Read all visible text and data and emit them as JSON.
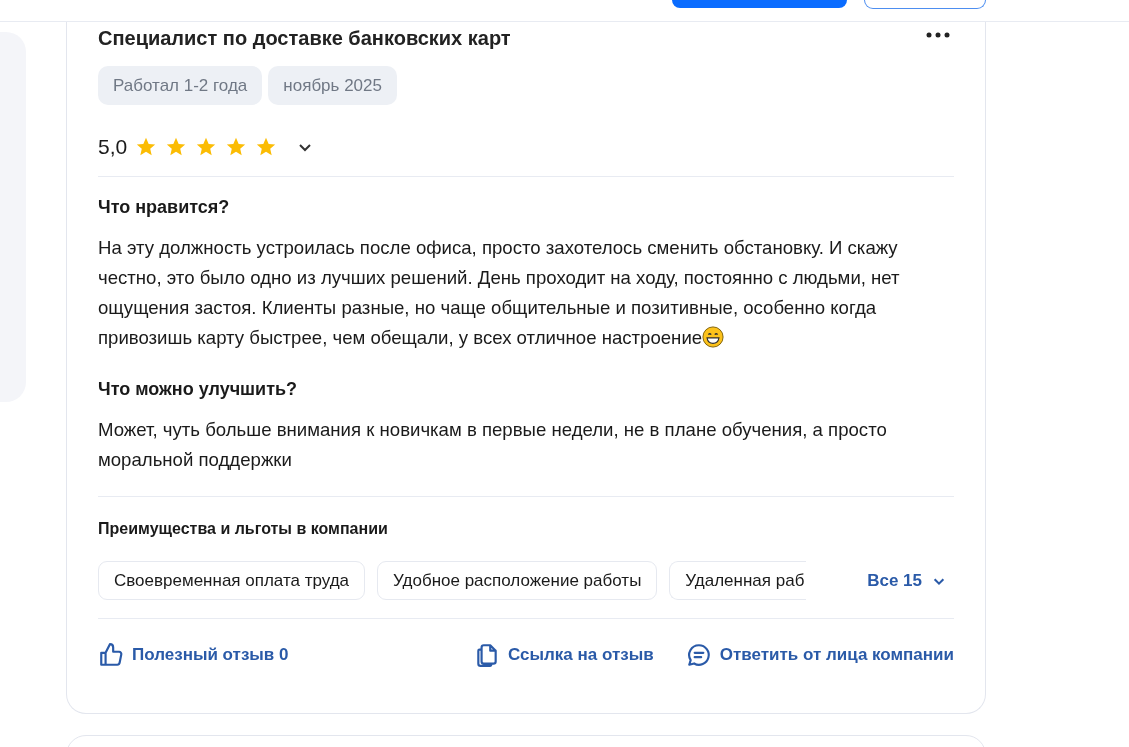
{
  "review": {
    "title": "Специалист по доставке банковских карт",
    "tags": [
      "Работал 1-2 года",
      "ноябрь 2025"
    ],
    "rating": {
      "value": "5,0",
      "stars": 5,
      "expanded": false
    },
    "sections": [
      {
        "heading": "Что нравится?",
        "text": "На эту должность устроилась после офиса, просто захотелось сменить обстановку. И скажу честно, это было одно из лучших решений. День проходит на ходу, постоянно с людьми, нет ощущения застоя. Клиенты разные, но чаще общительные и позитивные, особенно когда привозишь карту быстрее, чем обещали, у всех отличное настроение",
        "emoji": true
      },
      {
        "heading": "Что можно улучшить?",
        "text": "Может, чуть больше внимания к новичкам в первые недели, не в плане обучения, а просто моральной поддержки",
        "emoji": false
      }
    ],
    "benefits": {
      "heading": "Преимущества и льготы в компании",
      "items": [
        "Своевременная оплата труда",
        "Удобное расположение работы",
        "Удаленная раб"
      ],
      "more": "Все 15"
    },
    "actions": [
      {
        "kind": "like",
        "label": "Полезный отзыв 0"
      },
      {
        "kind": "link",
        "label": "Ссылка на отзыв"
      },
      {
        "kind": "reply",
        "label": "Ответить от лица компании"
      }
    ]
  }
}
